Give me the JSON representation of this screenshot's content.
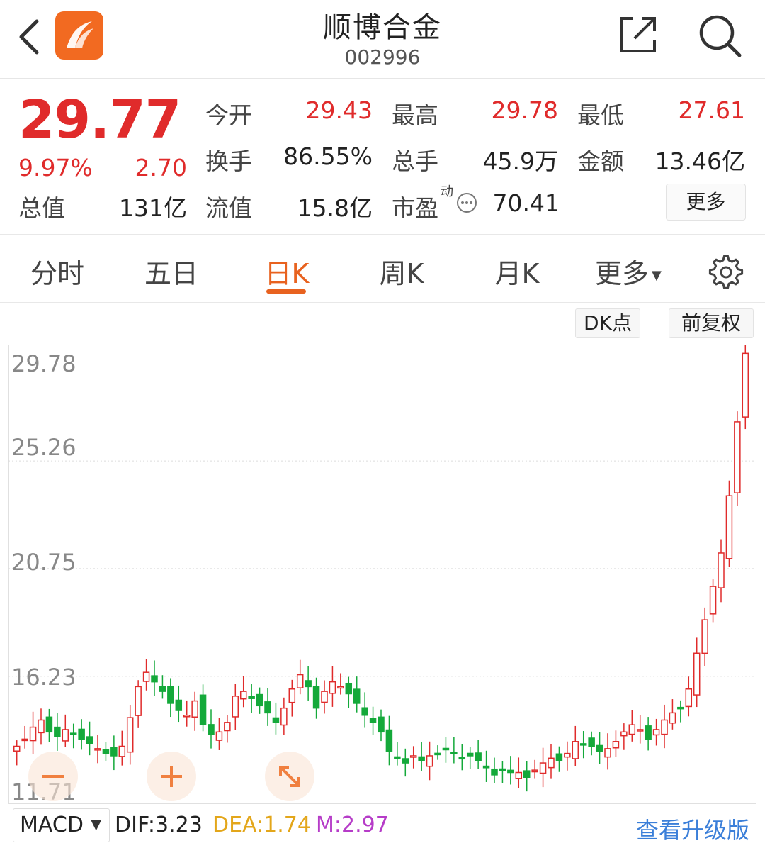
{
  "header": {
    "title": "顺博合金",
    "code": "002996",
    "icons": [
      "back-icon",
      "app-logo",
      "share-icon",
      "search-icon"
    ]
  },
  "quote": {
    "price": "29.77",
    "change_pct": "9.97%",
    "change": "2.70",
    "stats": [
      {
        "label": "今开",
        "value": "29.43"
      },
      {
        "label": "最高",
        "value": "29.78"
      },
      {
        "label": "最低",
        "value": "27.61"
      },
      {
        "label": "换手",
        "value": "86.55%"
      },
      {
        "label": "总手",
        "value": "45.9万"
      },
      {
        "label": "金额",
        "value": "13.46亿"
      },
      {
        "label": "总值",
        "value": "131亿"
      },
      {
        "label": "流值",
        "value": "15.8亿"
      },
      {
        "label": "市盈",
        "value": "70.41",
        "superscript": "动"
      }
    ],
    "more_label": "更多"
  },
  "tabs": [
    {
      "label": "分时"
    },
    {
      "label": "五日"
    },
    {
      "label": "日K",
      "active": true
    },
    {
      "label": "周K"
    },
    {
      "label": "月K"
    },
    {
      "label": "更多"
    }
  ],
  "chart_controls": {
    "dk_label": "DK点",
    "adjust_label": "前复权"
  },
  "chart_data": {
    "type": "candlestick",
    "y_ticks": [
      "29.78",
      "25.26",
      "20.75",
      "16.23",
      "11.71"
    ],
    "ylim": [
      11.71,
      29.78
    ],
    "colors": {
      "up": "#e02b2b",
      "down": "#14a93a"
    }
  },
  "indicator": {
    "selector": "MACD",
    "dif": "DIF:3.23",
    "dea": "DEA:1.74",
    "m": "M:2.97",
    "upgrade_link": "查看升级版",
    "colors": {
      "dea": "#e3a61a",
      "m": "#b63cc8",
      "link": "#3b7fd9"
    }
  }
}
